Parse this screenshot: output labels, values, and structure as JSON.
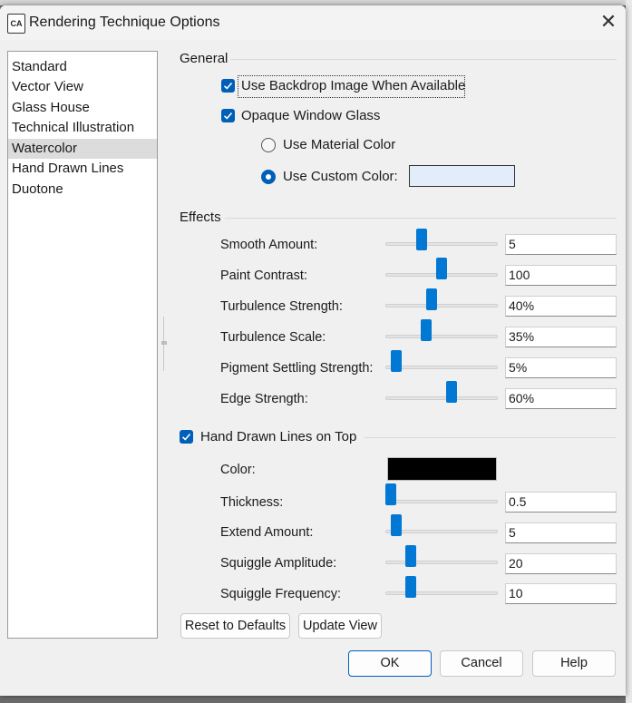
{
  "window": {
    "title": "Rendering Technique Options",
    "close_glyph": "✕",
    "icon_text": "CA"
  },
  "techniques": {
    "items": [
      "Standard",
      "Vector View",
      "Glass House",
      "Technical Illustration",
      "Watercolor",
      "Hand Drawn Lines",
      "Duotone"
    ],
    "selected": "Watercolor"
  },
  "general": {
    "label": "General",
    "use_backdrop": {
      "label": "Use Backdrop Image When Available",
      "checked": true
    },
    "opaque_glass": {
      "label": "Opaque Window Glass",
      "checked": true
    },
    "material_color": {
      "label": "Use Material Color",
      "selected": false
    },
    "custom_color": {
      "label": "Use Custom Color:",
      "selected": true,
      "color": "#e2ecfa"
    }
  },
  "effects": {
    "label": "Effects",
    "rows": [
      {
        "label": "Smooth Amount:",
        "value": "5",
        "level": 0.3
      },
      {
        "label": "Paint Contrast:",
        "value": "100",
        "level": 0.5
      },
      {
        "label": "Turbulence Strength:",
        "value": "40%",
        "level": 0.4
      },
      {
        "label": "Turbulence Scale:",
        "value": "35%",
        "level": 0.35
      },
      {
        "label": "Pigment Settling Strength:",
        "value": "5%",
        "level": 0.05
      },
      {
        "label": "Edge Strength:",
        "value": "60%",
        "level": 0.6
      }
    ]
  },
  "lines": {
    "label": "Hand Drawn Lines on Top",
    "checked": true,
    "color_label": "Color:",
    "color": "#000000",
    "rows": [
      {
        "label": "Thickness:",
        "value": "0.5",
        "level": 0.0
      },
      {
        "label": "Extend Amount:",
        "value": "5",
        "level": 0.05
      },
      {
        "label": "Squiggle Amplitude:",
        "value": "20",
        "level": 0.2
      },
      {
        "label": "Squiggle Frequency:",
        "value": "10",
        "level": 0.2
      }
    ]
  },
  "buttons": {
    "reset": "Reset to Defaults",
    "update": "Update View",
    "ok": "OK",
    "cancel": "Cancel",
    "help": "Help"
  },
  "colors": {
    "accent": "#0078d4",
    "checkbox": "#005fb8",
    "selection": "#dcdcdc"
  }
}
